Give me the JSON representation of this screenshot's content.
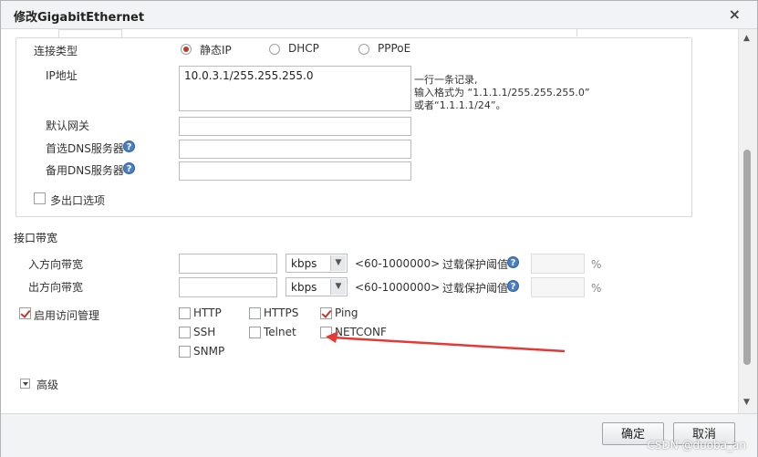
{
  "dialog": {
    "title": "修改GigabitEthernet",
    "close_glyph": "×"
  },
  "connection": {
    "label": "连接类型",
    "options": [
      {
        "label": "静态IP",
        "selected": true
      },
      {
        "label": "DHCP",
        "selected": false
      },
      {
        "label": "PPPoE",
        "selected": false
      }
    ]
  },
  "ip": {
    "label": "IP地址",
    "value": "10.0.3.1/255.255.255.0",
    "hint_line1": "一行一条记录,",
    "hint_line2": "输入格式为 “1.1.1.1/255.255.255.0”",
    "hint_line3": "或者“1.1.1.1/24”。"
  },
  "gateway": {
    "label": "默认网关",
    "value": ""
  },
  "dns1": {
    "label": "首选DNS服务器",
    "help": "?",
    "value": ""
  },
  "dns2": {
    "label": "备用DNS服务器",
    "help": "?",
    "value": ""
  },
  "multi_egress": {
    "label": "多出口选项",
    "checked": false
  },
  "bandwidth": {
    "section_title": "接口带宽",
    "inbound_label": "入方向带宽",
    "outbound_label": "出方向带宽",
    "unit": "kbps",
    "range": "<60-1000000>",
    "overload_label": "过载保护阈值",
    "help": "?",
    "percent": "%"
  },
  "access": {
    "label": "启用访问管理",
    "checked": true,
    "services": [
      {
        "label": "HTTP",
        "checked": false
      },
      {
        "label": "HTTPS",
        "checked": false
      },
      {
        "label": "Ping",
        "checked": true
      },
      {
        "label": "SSH",
        "checked": false
      },
      {
        "label": "Telnet",
        "checked": false
      },
      {
        "label": "NETCONF",
        "checked": false
      },
      {
        "label": "SNMP",
        "checked": false
      }
    ]
  },
  "advanced": {
    "label": "高级"
  },
  "footer": {
    "ok_label": "确定",
    "cancel_label": "取消"
  },
  "watermark": "CSDN @duoba_an",
  "colors": {
    "accent": "#c0392b",
    "help_blue": "#4a7fc1",
    "annotation_red": "#e53935"
  }
}
